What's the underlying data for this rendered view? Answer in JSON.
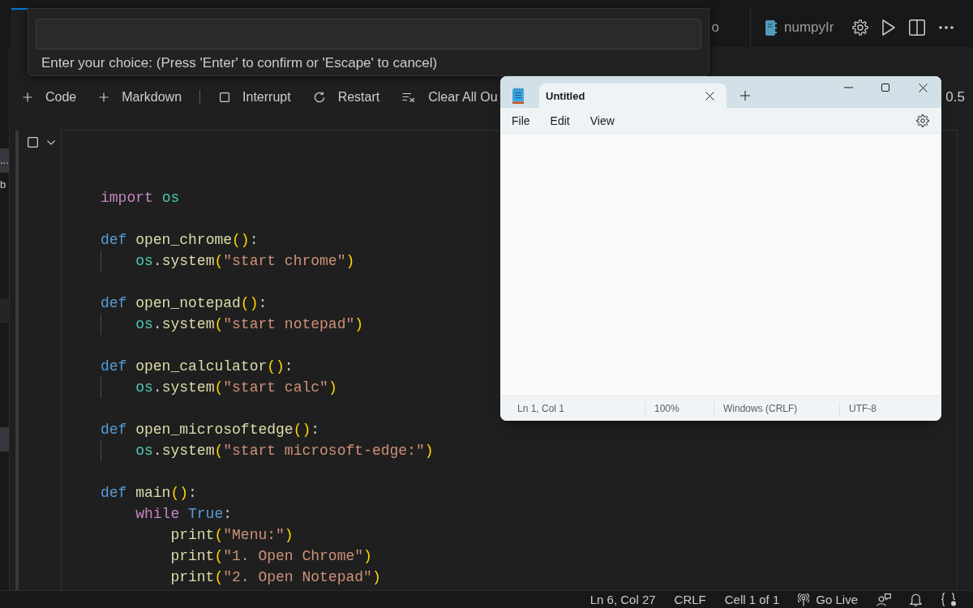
{
  "tab_bar": {
    "groups": [
      {
        "tabs": [
          {
            "kind": "file",
            "selected": true
          },
          {
            "kind": "file",
            "label": "o",
            "selected": false
          }
        ]
      },
      {
        "tabs": [
          {
            "kind": "notebook",
            "label": "numpyIr",
            "selected": false
          }
        ]
      }
    ]
  },
  "quick_input": {
    "message": "Enter your choice: (Press 'Enter' to confirm or 'Escape' to cancel)"
  },
  "sidebar": {
    "sections": [
      {
        "items": [
          {
            "label": "...",
            "selected": true
          },
          {
            "label": "b",
            "selected": false
          }
        ]
      },
      {
        "items": [
          {
            "selected": true
          }
        ]
      }
    ]
  },
  "notebook": {
    "toolbar": {
      "groups": [
        [
          {
            "kind": "add",
            "label": "Code"
          },
          {
            "kind": "add",
            "label": "Markdown"
          }
        ],
        [
          {
            "kind": "interrupt",
            "label": "Interrupt"
          },
          {
            "kind": "restart",
            "label": "Restart"
          },
          {
            "kind": "clear",
            "label": "Clear All Ou"
          }
        ]
      ],
      "kernel_label": "0.5"
    },
    "cell": {
      "blocks": [
        [
          {
            "tokens": [
              {
                "kind": "control",
                "text": "import "
              },
              {
                "kind": "module",
                "text": "os"
              }
            ]
          }
        ],
        [
          {
            "tokens": [
              {
                "kind": "storage",
                "text": "def "
              },
              {
                "kind": "function",
                "text": "open_chrome"
              },
              {
                "kind": "bracket",
                "text": "()"
              },
              {
                "kind": "plain",
                "text": ":"
              }
            ],
            "guides": true,
            "children": [
              {
                "tokens": [
                  {
                    "kind": "module",
                    "text": "os"
                  },
                  {
                    "kind": "plain",
                    "text": "."
                  },
                  {
                    "kind": "function",
                    "text": "system"
                  },
                  {
                    "kind": "bracket",
                    "text": "("
                  },
                  {
                    "kind": "string",
                    "text": "\"start chrome\""
                  },
                  {
                    "kind": "bracket",
                    "text": ")"
                  }
                ]
              }
            ]
          }
        ],
        [
          {
            "tokens": [
              {
                "kind": "storage",
                "text": "def "
              },
              {
                "kind": "function",
                "text": "open_notepad"
              },
              {
                "kind": "bracket",
                "text": "()"
              },
              {
                "kind": "plain",
                "text": ":"
              }
            ],
            "guides": true,
            "children": [
              {
                "tokens": [
                  {
                    "kind": "module",
                    "text": "os"
                  },
                  {
                    "kind": "plain",
                    "text": "."
                  },
                  {
                    "kind": "function",
                    "text": "system"
                  },
                  {
                    "kind": "bracket",
                    "text": "("
                  },
                  {
                    "kind": "string",
                    "text": "\"start notepad\""
                  },
                  {
                    "kind": "bracket",
                    "text": ")"
                  }
                ]
              }
            ]
          }
        ],
        [
          {
            "tokens": [
              {
                "kind": "storage",
                "text": "def "
              },
              {
                "kind": "function",
                "text": "open_calculator"
              },
              {
                "kind": "bracket",
                "text": "()"
              },
              {
                "kind": "plain",
                "text": ":"
              }
            ],
            "guides": true,
            "children": [
              {
                "tokens": [
                  {
                    "kind": "module",
                    "text": "os"
                  },
                  {
                    "kind": "plain",
                    "text": "."
                  },
                  {
                    "kind": "function",
                    "text": "system"
                  },
                  {
                    "kind": "bracket",
                    "text": "("
                  },
                  {
                    "kind": "string",
                    "text": "\"start calc\""
                  },
                  {
                    "kind": "bracket",
                    "text": ")"
                  }
                ]
              }
            ]
          }
        ],
        [
          {
            "tokens": [
              {
                "kind": "storage",
                "text": "def "
              },
              {
                "kind": "function",
                "text": "open_microsoftedge"
              },
              {
                "kind": "bracket",
                "text": "()"
              },
              {
                "kind": "plain",
                "text": ":"
              }
            ],
            "guides": true,
            "children": [
              {
                "tokens": [
                  {
                    "kind": "module",
                    "text": "os"
                  },
                  {
                    "kind": "plain",
                    "text": "."
                  },
                  {
                    "kind": "function",
                    "text": "system"
                  },
                  {
                    "kind": "bracket",
                    "text": "("
                  },
                  {
                    "kind": "string",
                    "text": "\"start microsoft-edge:\""
                  },
                  {
                    "kind": "bracket",
                    "text": ")"
                  }
                ]
              }
            ]
          }
        ],
        [
          {
            "tokens": [
              {
                "kind": "storage",
                "text": "def "
              },
              {
                "kind": "function",
                "text": "main"
              },
              {
                "kind": "bracket",
                "text": "()"
              },
              {
                "kind": "plain",
                "text": ":"
              }
            ],
            "guides": false,
            "children": [
              {
                "tokens": [
                  {
                    "kind": "control",
                    "text": "while "
                  },
                  {
                    "kind": "storage",
                    "text": "True"
                  },
                  {
                    "kind": "plain",
                    "text": ":"
                  }
                ],
                "guides": false,
                "children": [
                  {
                    "tokens": [
                      {
                        "kind": "function",
                        "text": "print"
                      },
                      {
                        "kind": "bracket",
                        "text": "("
                      },
                      {
                        "kind": "string",
                        "text": "\"Menu:\""
                      },
                      {
                        "kind": "bracket",
                        "text": ")"
                      }
                    ]
                  },
                  {
                    "tokens": [
                      {
                        "kind": "function",
                        "text": "print"
                      },
                      {
                        "kind": "bracket",
                        "text": "("
                      },
                      {
                        "kind": "string",
                        "text": "\"1. Open Chrome\""
                      },
                      {
                        "kind": "bracket",
                        "text": ")"
                      }
                    ]
                  },
                  {
                    "tokens": [
                      {
                        "kind": "function",
                        "text": "print"
                      },
                      {
                        "kind": "bracket",
                        "text": "("
                      },
                      {
                        "kind": "string",
                        "text": "\"2. Open Notepad\""
                      },
                      {
                        "kind": "bracket",
                        "text": ")"
                      }
                    ]
                  }
                ]
              }
            ]
          }
        ]
      ]
    }
  },
  "notepad": {
    "tabs": [
      {
        "label": "Untitled",
        "selected": true
      }
    ],
    "menu": [
      "File",
      "Edit",
      "View"
    ],
    "status": [
      "Ln 1, Col 1",
      "100%",
      "Windows (CRLF)",
      "UTF-8"
    ]
  },
  "status_bar": {
    "items": [
      {
        "kind": "text",
        "label": "Ln 6, Col 27"
      },
      {
        "kind": "text",
        "label": "CRLF"
      },
      {
        "kind": "text",
        "label": "Cell 1 of 1"
      },
      {
        "kind": "live",
        "label": "Go Live"
      }
    ]
  }
}
